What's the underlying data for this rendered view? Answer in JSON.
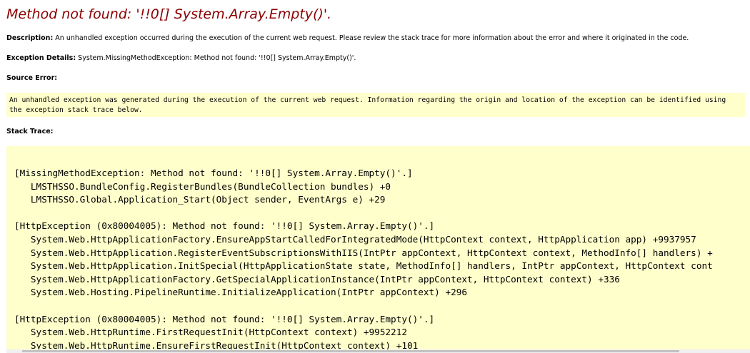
{
  "error": {
    "title": "Method not found: '!!0[] System.Array.Empty()'.",
    "description_label": "Description:",
    "description_text": "An unhandled exception occurred during the execution of the current web request. Please review the stack trace for more information about the error and where it originated in the code.",
    "details_label": "Exception Details:",
    "details_text": "System.MissingMethodException: Method not found: '!!0[] System.Array.Empty()'.",
    "source_heading": "Source Error:",
    "source_text": "An unhandled exception was generated during the execution of the current web request. Information regarding the origin and location of the exception can be identified using the exception stack trace below.",
    "stack_heading": "Stack Trace:",
    "stack_lines": [
      "[MissingMethodException: Method not found: '!!0[] System.Array.Empty()'.]",
      "   LMSTHSSO.BundleConfig.RegisterBundles(BundleCollection bundles) +0",
      "   LMSTHSSO.Global.Application_Start(Object sender, EventArgs e) +29",
      "",
      "[HttpException (0x80004005): Method not found: '!!0[] System.Array.Empty()'.]",
      "   System.Web.HttpApplicationFactory.EnsureAppStartCalledForIntegratedMode(HttpContext context, HttpApplication app) +9937957",
      "   System.Web.HttpApplication.RegisterEventSubscriptionsWithIIS(IntPtr appContext, HttpContext context, MethodInfo[] handlers) +",
      "   System.Web.HttpApplication.InitSpecial(HttpApplicationState state, MethodInfo[] handlers, IntPtr appContext, HttpContext cont",
      "   System.Web.HttpApplicationFactory.GetSpecialApplicationInstance(IntPtr appContext, HttpContext context) +336",
      "   System.Web.Hosting.PipelineRuntime.InitializeApplication(IntPtr appContext) +296",
      "",
      "[HttpException (0x80004005): Method not found: '!!0[] System.Array.Empty()'.]",
      "   System.Web.HttpRuntime.FirstRequestInit(HttpContext context) +9952212",
      "   System.Web.HttpRuntime.EnsureFirstRequestInit(HttpContext context) +101"
    ]
  },
  "colors": {
    "title": "#8b0000",
    "code_background": "#ffffcc"
  }
}
